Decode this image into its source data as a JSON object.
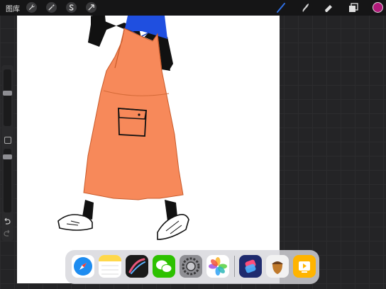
{
  "topbar": {
    "gallery_label": "图库",
    "left_tools": [
      {
        "icon": "wrench-icon",
        "name": "actions"
      },
      {
        "icon": "magic-wand-icon",
        "name": "adjustments"
      },
      {
        "icon": "selection-s-icon",
        "name": "selection"
      },
      {
        "icon": "arrow-cursor-icon",
        "name": "transform"
      }
    ],
    "right_tools": [
      {
        "icon": "brush-icon",
        "name": "paint",
        "active": true
      },
      {
        "icon": "smudge-icon",
        "name": "smudge"
      },
      {
        "icon": "eraser-icon",
        "name": "erase"
      },
      {
        "icon": "layers-icon",
        "name": "layers"
      }
    ],
    "current_color": "#b01a7a",
    "active_tool_color": "#2f6fe4"
  },
  "canvas": {
    "background": "#ffffff",
    "artwork": {
      "dress_color": "#f7895a",
      "hair_color": "#1f4fe0",
      "shirt_color": "#111111"
    }
  },
  "sidebar": {
    "controls": [
      "brush-size-slider",
      "modify-button",
      "opacity-slider",
      "undo",
      "redo"
    ]
  },
  "dock": {
    "apps": [
      {
        "name": "safari",
        "icon": "safari-icon",
        "color": "#1e8cf0"
      },
      {
        "name": "notes",
        "icon": "notes-icon",
        "color": "#ffd84a"
      },
      {
        "name": "procreate",
        "icon": "procreate-icon",
        "color": "#1a1a1a"
      },
      {
        "name": "wechat",
        "icon": "wechat-icon",
        "color": "#2dc100"
      },
      {
        "name": "settings",
        "icon": "settings-icon",
        "color": "#8e8e93"
      },
      {
        "name": "photos",
        "icon": "photos-icon",
        "color": "#ffffff"
      },
      {
        "name": "shortcuts",
        "icon": "shortcuts-icon",
        "color": "#1f2b6e"
      },
      {
        "name": "acorn",
        "icon": "acorn-icon",
        "color": "#f2f2f2"
      },
      {
        "name": "keynote-play",
        "icon": "play-icon",
        "color": "#ffb400"
      }
    ]
  }
}
